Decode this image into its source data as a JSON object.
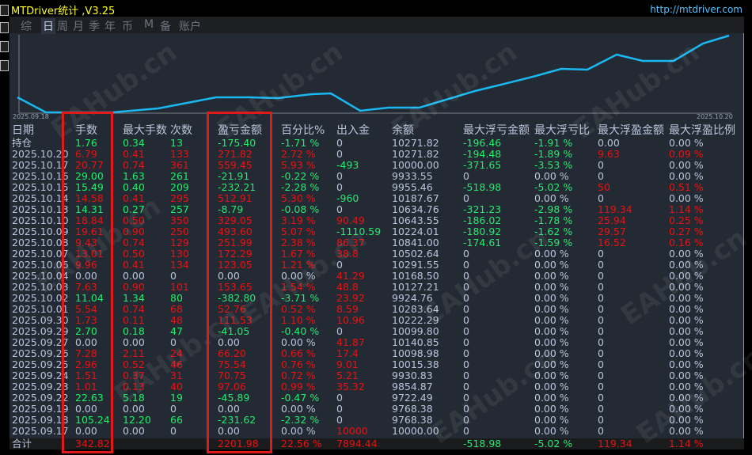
{
  "window": {
    "title": "MTDriver统计 ,V3.25",
    "url": "http://mtdriver.com"
  },
  "tabs": [
    {
      "label": "综",
      "active": false
    },
    {
      "label": "日",
      "active": true
    },
    {
      "label": "周",
      "active": false
    },
    {
      "label": "月",
      "active": false
    },
    {
      "label": "季",
      "active": false
    },
    {
      "label": "年",
      "active": false
    },
    {
      "label": "币",
      "active": false
    },
    {
      "label": "M",
      "active": false
    },
    {
      "label": "备",
      "active": false
    },
    {
      "label": "账户",
      "active": false
    }
  ],
  "chart": {
    "x_start_label": "2025.09.18",
    "x_end_label": "2025.10.20",
    "line_color": "#1ab8f0"
  },
  "watermark": "EAHub.cn",
  "colors": {
    "profit": "#e41414",
    "loss": "#1ef06a",
    "neutral": "#b8c6dc"
  },
  "headers": [
    "日期",
    "手数",
    "最大手数",
    "次数",
    "盈亏金额",
    "百分比%",
    "出入金",
    "余额",
    "最大浮亏金额",
    "最大浮亏比",
    "最大浮盈金额",
    "最大浮盈比例"
  ],
  "rows": [
    [
      "持仓",
      "1.76",
      "0.34",
      "13",
      "-175.40",
      "-1.71 %",
      "0",
      "10271.82",
      "-196.46",
      "-1.91 %",
      "0.00",
      "0.00 %"
    ],
    [
      "2025.10.20",
      "6.79",
      "0.41",
      "133",
      "271.82",
      "2.72 %",
      "0",
      "10271.82",
      "-194.48",
      "-1.89 %",
      "9.63",
      "0.09 %"
    ],
    [
      "2025.10.17",
      "20.77",
      "0.74",
      "361",
      "559.45",
      "5.93 %",
      "-493",
      "10000.00",
      "-371.65",
      "-3.53 %",
      "0",
      "0.00 %"
    ],
    [
      "2025.10.16",
      "29.00",
      "1.63",
      "261",
      "-21.91",
      "-0.22 %",
      "0",
      "9933.55",
      "0",
      "0.00 %",
      "0",
      "0.00 %"
    ],
    [
      "2025.10.15",
      "15.49",
      "0.40",
      "209",
      "-232.21",
      "-2.28 %",
      "0",
      "9955.46",
      "-518.98",
      "-5.02 %",
      "50",
      "0.51 %"
    ],
    [
      "2025.10.14",
      "14.58",
      "0.41",
      "295",
      "512.91",
      "5.30 %",
      "-960",
      "10187.67",
      "0",
      "0.00 %",
      "0",
      "0.00 %"
    ],
    [
      "2025.10.13",
      "14.31",
      "0.27",
      "257",
      "-8.79",
      "-0.08 %",
      "0",
      "10634.76",
      "-321.23",
      "-2.98 %",
      "119.34",
      "1.14 %"
    ],
    [
      "2025.10.10",
      "18.84",
      "0.50",
      "350",
      "329.05",
      "3.19 %",
      "90.49",
      "10643.55",
      "-186.02",
      "-1.78 %",
      "25.94",
      "0.25 %"
    ],
    [
      "2025.10.09",
      "19.61",
      "0.90",
      "250",
      "493.60",
      "5.07 %",
      "-1110.59",
      "10224.01",
      "-180.92",
      "-1.62 %",
      "29.57",
      "0.27 %"
    ],
    [
      "2025.10.08",
      "9.43",
      "0.74",
      "129",
      "251.99",
      "2.38 %",
      "86.37",
      "10841.00",
      "-174.61",
      "-1.59 %",
      "16.52",
      "0.16 %"
    ],
    [
      "2025.10.07",
      "13.01",
      "0.50",
      "130",
      "172.29",
      "1.67 %",
      "38.8",
      "10502.64",
      "0",
      "0.00 %",
      "0",
      "0.00 %"
    ],
    [
      "2025.10.06",
      "9.96",
      "0.41",
      "134",
      "123.05",
      "1.21 %",
      "0",
      "10291.55",
      "0",
      "0.00 %",
      "0",
      "0.00 %"
    ],
    [
      "2025.10.04",
      "0.00",
      "0.00",
      "0",
      "0.00",
      "0.00 %",
      "41.29",
      "10168.50",
      "0",
      "0.00 %",
      "0",
      "0.00 %"
    ],
    [
      "2025.10.03",
      "7.63",
      "0.90",
      "101",
      "153.65",
      "1.54 %",
      "48.8",
      "10127.21",
      "0",
      "0.00 %",
      "0",
      "0.00 %"
    ],
    [
      "2025.10.02",
      "11.04",
      "1.34",
      "80",
      "-382.80",
      "-3.71 %",
      "23.92",
      "9924.76",
      "0",
      "0.00 %",
      "0",
      "0.00 %"
    ],
    [
      "2025.10.01",
      "5.54",
      "0.74",
      "68",
      "52.76",
      "0.52 %",
      "8.59",
      "10283.64",
      "0",
      "0.00 %",
      "0",
      "0.00 %"
    ],
    [
      "2025.09.30",
      "1.73",
      "0.11",
      "48",
      "111.53",
      "1.10 %",
      "10.96",
      "10222.29",
      "0",
      "0.00 %",
      "0",
      "0.00 %"
    ],
    [
      "2025.09.29",
      "2.70",
      "0.18",
      "47",
      "-41.05",
      "-0.40 %",
      "0",
      "10099.80",
      "0",
      "0.00 %",
      "0",
      "0.00 %"
    ],
    [
      "2025.09.27",
      "0.00",
      "0.00",
      "0",
      "0.00",
      "0.00 %",
      "41.87",
      "10140.85",
      "0",
      "0.00 %",
      "0",
      "0.00 %"
    ],
    [
      "2025.09.26",
      "7.28",
      "2.11",
      "24",
      "66.20",
      "0.66 %",
      "17.4",
      "10098.98",
      "0",
      "0.00 %",
      "0",
      "0.00 %"
    ],
    [
      "2025.09.25",
      "2.96",
      "0.52",
      "46",
      "75.54",
      "0.76 %",
      "9.01",
      "10015.38",
      "0",
      "0.00 %",
      "0",
      "0.00 %"
    ],
    [
      "2025.09.24",
      "1.51",
      "0.37",
      "31",
      "70.75",
      "0.72 %",
      "5.21",
      "9930.83",
      "0",
      "0.00 %",
      "0",
      "0.00 %"
    ],
    [
      "2025.09.23",
      "1.01",
      "0.13",
      "40",
      "97.06",
      "0.99 %",
      "35.32",
      "9854.87",
      "0",
      "0.00 %",
      "0",
      "0.00 %"
    ],
    [
      "2025.09.22",
      "22.63",
      "5.18",
      "19",
      "-45.89",
      "-0.47 %",
      "0",
      "9722.49",
      "0",
      "0.00 %",
      "0",
      "0.00 %"
    ],
    [
      "2025.09.19",
      "0.00",
      "0.00",
      "0",
      "0.00",
      "0.00 %",
      "0",
      "9768.38",
      "0",
      "0.00 %",
      "0",
      "0.00 %"
    ],
    [
      "2025.09.18",
      "105.24",
      "12.20",
      "66",
      "-231.62",
      "-2.32 %",
      "0",
      "9768.38",
      "0",
      "0.00 %",
      "0",
      "0.00 %"
    ],
    [
      "2025.09.17",
      "0.00",
      "0.00",
      "0",
      "0.00",
      "0.00 %",
      "10000",
      "10000.00",
      "0",
      "0.00 %",
      "0",
      "0.00 %"
    ]
  ],
  "total": [
    "合计",
    "342.82",
    "",
    "",
    "2201.98",
    "22.56 %",
    "7894.44",
    "",
    "-518.98",
    "-5.02 %",
    "119.34",
    "1.14 %"
  ]
}
